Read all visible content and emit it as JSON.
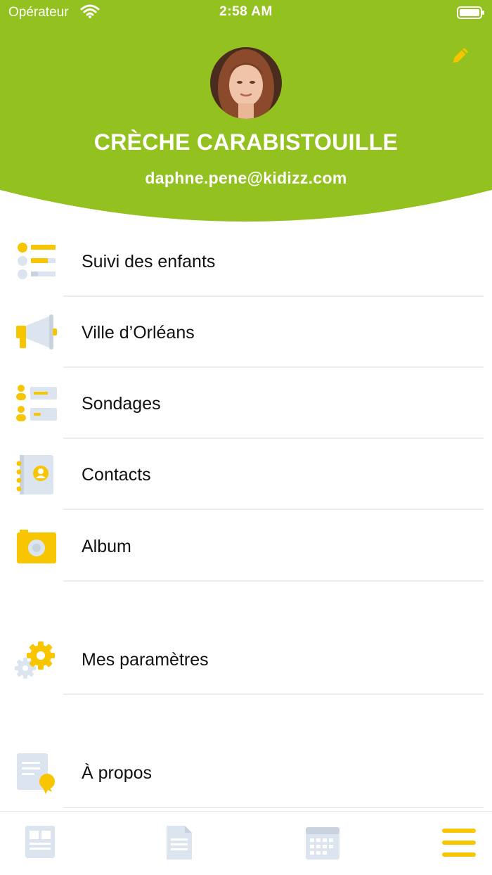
{
  "status_bar": {
    "carrier": "Opérateur",
    "time": "2:58 AM"
  },
  "colors": {
    "header": "#93c120",
    "accent": "#f7c600",
    "icon_light": "#dbe4ef",
    "text": "#111111"
  },
  "header": {
    "org_name": "CRÈCHE CARABISTOUILLE",
    "email": "daphne.pene@kidizz.com",
    "edit_icon": "pencil-icon"
  },
  "menu": [
    {
      "label": "Suivi des enfants",
      "icon": "child-tracking-icon"
    },
    {
      "label": "Ville d’Orléans",
      "icon": "megaphone-icon"
    },
    {
      "label": "Sondages",
      "icon": "survey-icon"
    },
    {
      "label": "Contacts",
      "icon": "address-book-icon"
    },
    {
      "label": "Album",
      "icon": "camera-icon"
    },
    {
      "label": "Mes paramètres",
      "icon": "gears-icon"
    },
    {
      "label": "À propos",
      "icon": "certificate-icon"
    }
  ],
  "tabbar": {
    "tabs": [
      {
        "icon": "newspaper-icon",
        "active": false
      },
      {
        "icon": "document-icon",
        "active": false
      },
      {
        "icon": "calendar-icon",
        "active": false
      },
      {
        "icon": "menu-icon",
        "active": true
      }
    ]
  }
}
